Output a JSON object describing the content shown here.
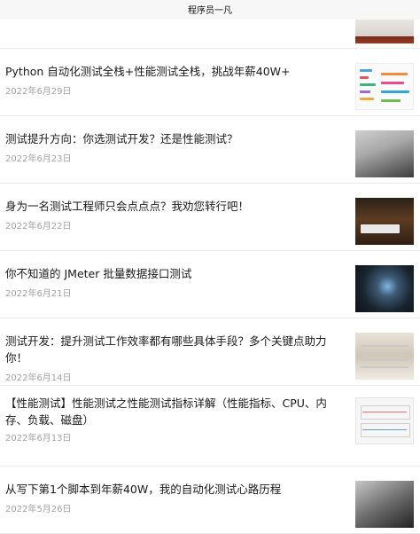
{
  "header": {
    "title": "程序员一凡"
  },
  "articles": [
    {
      "title": "Python 自动化测试全栈+性能测试全栈，挑战年薪40W+",
      "date": "2022年6月29日",
      "thumb": "mind-map-thumbnail"
    },
    {
      "title": "测试提升方向：你选测试开发？还是性能测试？",
      "date": "2022年6月23日",
      "thumb": "laptop-thumbnail"
    },
    {
      "title": "身为一名测试工程师只会点点点？我劝您转行吧！",
      "date": "2022年6月22日",
      "thumb": "keyboard-desk-thumbnail"
    },
    {
      "title": "你不知道的 JMeter 批量数据接口测试",
      "date": "2022年6月21日",
      "thumb": "cables-thumbnail"
    },
    {
      "title": "测试开发：提升测试工作效率都有哪些具体手段？多个关键点助力你！",
      "date": "2022年6月14日",
      "thumb": "desk-papers-thumbnail"
    },
    {
      "title": "【性能测试】性能测试之性能测试指标详解（性能指标、CPU、内存、负载、磁盘）",
      "date": "2022年6月13日",
      "thumb": "charts-screenshot-thumbnail"
    },
    {
      "title": "从写下第1个脚本到年薪40W，我的自动化测试心路历程",
      "date": "2022年5月26日",
      "thumb": "laptop-dark-thumbnail"
    }
  ]
}
